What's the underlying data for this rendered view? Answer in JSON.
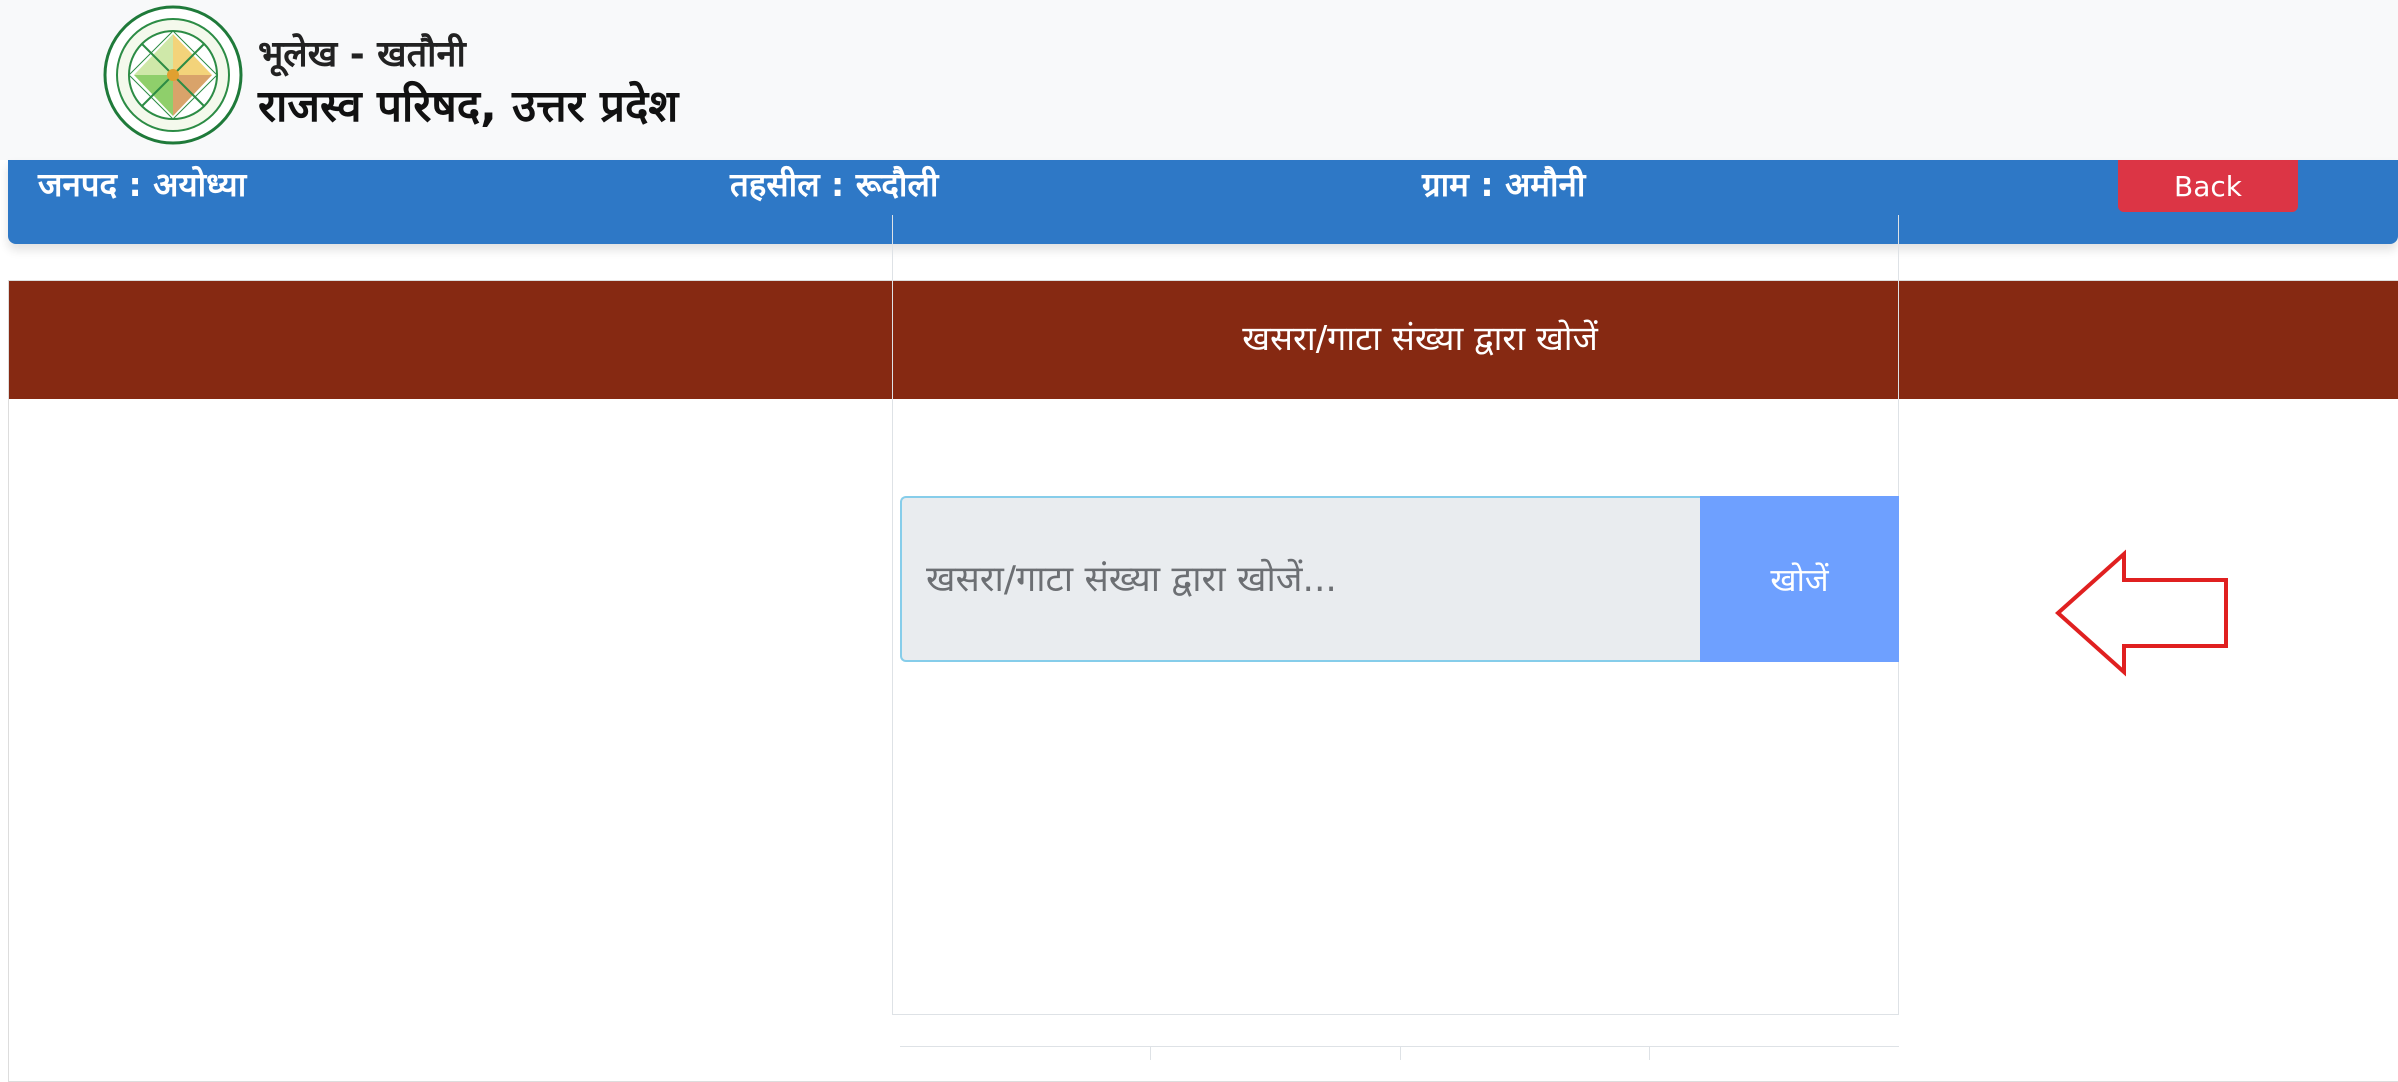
{
  "header": {
    "subtitle": "भूलेख - खतौनी",
    "title": "राजस्व परिषद, उत्तर प्रदेश"
  },
  "location": {
    "district": "जनपद : अयोध्या",
    "tehsil": "तहसील : रूदौली",
    "village": "ग्राम : अमौनी",
    "back_label": "Back"
  },
  "search_card": {
    "title": "खसरा/गाटा संख्या द्वारा खोजें",
    "input_placeholder": "खसरा/गाटा संख्या द्वारा खोजें...",
    "input_value": "",
    "button_label": "खोजें"
  },
  "icons": {
    "logo": "revenue-board-seal-icon",
    "arrow": "arrow-left-outline-icon"
  },
  "colors": {
    "location_bar": "#2e78c6",
    "card_header": "#862912",
    "back_button": "#dc3545",
    "search_button": "#6ea0ff",
    "arrow": "#e02020"
  }
}
